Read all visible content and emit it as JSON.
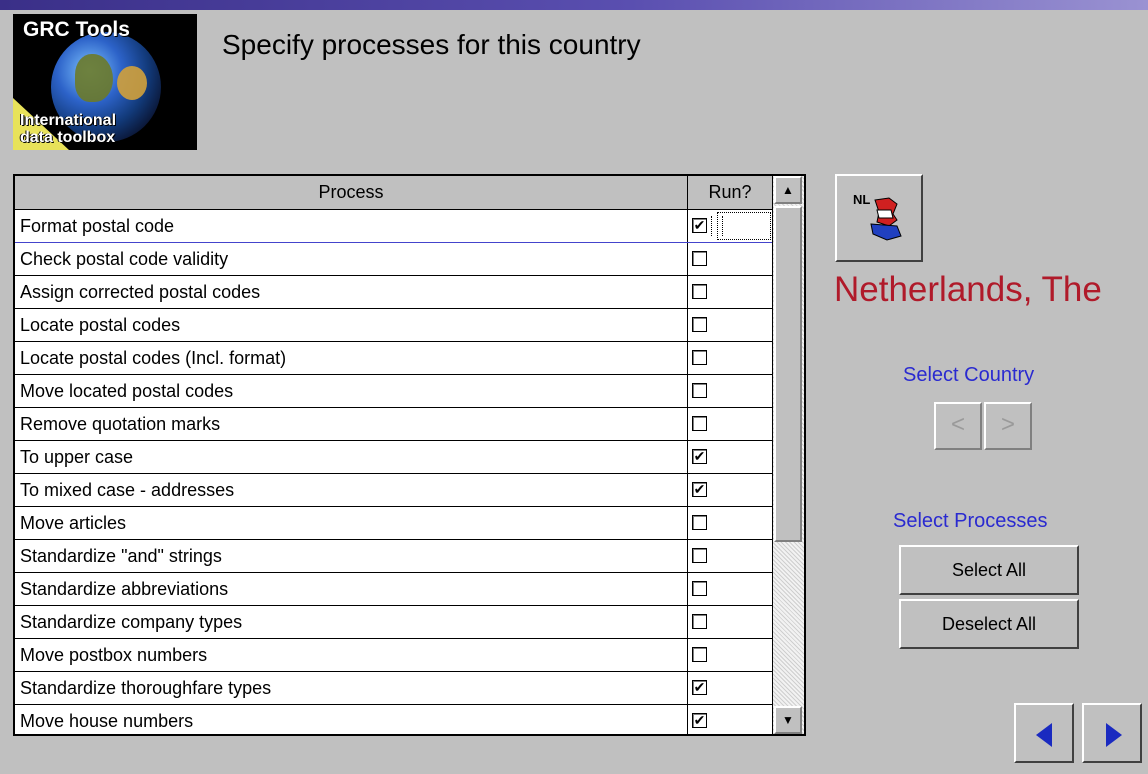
{
  "header": {
    "title": "Specify processes for this country",
    "logo": {
      "line1": "GRC Tools",
      "line2": "International",
      "line3": "data toolbox"
    }
  },
  "grid": {
    "columns": {
      "process": "Process",
      "run": "Run?"
    },
    "rows": [
      {
        "name": "Format postal code",
        "run": true,
        "active": true
      },
      {
        "name": "Check postal code validity",
        "run": false
      },
      {
        "name": "Assign corrected postal codes",
        "run": false
      },
      {
        "name": "Locate postal codes",
        "run": false
      },
      {
        "name": "Locate postal codes (Incl. format)",
        "run": false
      },
      {
        "name": "Move located postal codes",
        "run": false
      },
      {
        "name": "Remove quotation marks",
        "run": false
      },
      {
        "name": "To upper case",
        "run": true
      },
      {
        "name": "To mixed case - addresses",
        "run": true
      },
      {
        "name": "Move articles",
        "run": false
      },
      {
        "name": "Standardize \"and\" strings",
        "run": false
      },
      {
        "name": "Standardize abbreviations",
        "run": false
      },
      {
        "name": "Standardize company types",
        "run": false
      },
      {
        "name": "Move postbox numbers",
        "run": false
      },
      {
        "name": "Standardize thoroughfare types",
        "run": true
      },
      {
        "name": "Move house numbers",
        "run": true
      }
    ],
    "check_glyph": "✔"
  },
  "country": {
    "flag_label": "NL",
    "name": "Netherlands, The",
    "select_label": "Select Country",
    "prev_glyph": "<",
    "next_glyph": ">"
  },
  "processes": {
    "select_label": "Select Processes",
    "select_all": "Select All",
    "deselect_all": "Deselect All"
  },
  "scrollbar": {
    "up_glyph": "▲",
    "down_glyph": "▼"
  },
  "colors": {
    "country_name": "#b01a2a",
    "link_text": "#2a2ad0",
    "nav_arrow": "#1a2ac0"
  }
}
